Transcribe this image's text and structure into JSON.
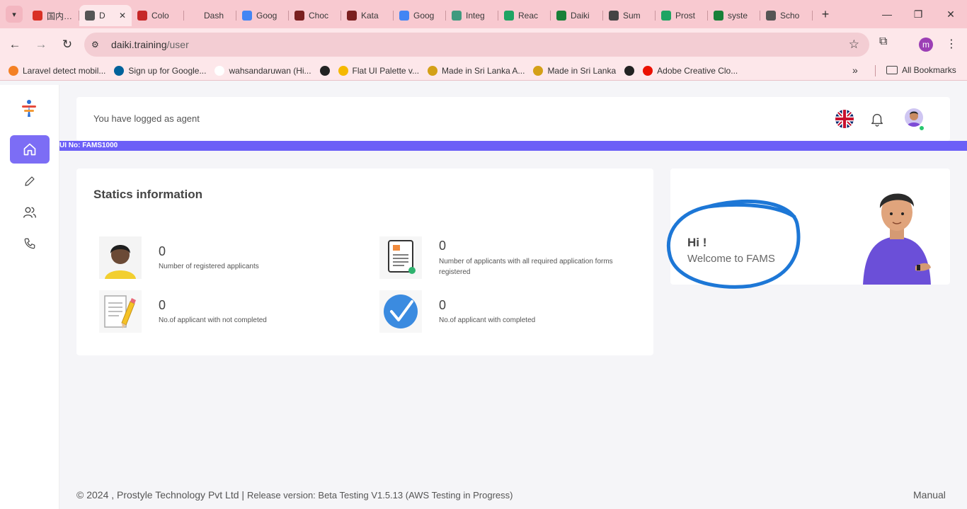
{
  "browser": {
    "tabs": [
      {
        "label": "国内…",
        "color": "#d93025"
      },
      {
        "label": "D",
        "color": "#555555",
        "active": true
      },
      {
        "label": "Colo",
        "color": "#c62828"
      },
      {
        "label": "Dash",
        "color": "#f8c9d0"
      },
      {
        "label": "Goog",
        "color": "#4285f4"
      },
      {
        "label": "Choc",
        "color": "#7a1f1f"
      },
      {
        "label": "Kata",
        "color": "#7a1f1f"
      },
      {
        "label": "Goog",
        "color": "#4285f4"
      },
      {
        "label": "Integ",
        "color": "#3f9a7f"
      },
      {
        "label": "Reac",
        "color": "#1fa463"
      },
      {
        "label": "Daiki",
        "color": "#188038"
      },
      {
        "label": "Sum",
        "color": "#444444"
      },
      {
        "label": "Prost",
        "color": "#1fa463"
      },
      {
        "label": "syste",
        "color": "#188038"
      },
      {
        "label": "Scho",
        "color": "#555555"
      }
    ],
    "url_host": "daiki.training",
    "url_path": "/user",
    "profile_initial": "m",
    "bookmarks": [
      {
        "label": "Laravel detect mobil...",
        "color": "#f48024"
      },
      {
        "label": "Sign up for Google...",
        "color": "#00629b"
      },
      {
        "label": "wahsandaruwan (Hi...",
        "color": "#ffffff"
      },
      {
        "label": "",
        "color": "#222222"
      },
      {
        "label": "Flat UI Palette v...",
        "color": "#f5b800"
      },
      {
        "label": "Made in Sri Lanka A...",
        "color": "#d4a017"
      },
      {
        "label": "Made in Sri Lanka",
        "color": "#d4a017"
      },
      {
        "label": "",
        "color": "#222222"
      },
      {
        "label": "Adobe Creative Clo...",
        "color": "#eb1000"
      }
    ],
    "all_bookmarks_label": "All Bookmarks"
  },
  "app": {
    "status_text": "You have logged as agent",
    "ui_no": "UI No: FAMS1000",
    "stats_title": "Statics information",
    "stats": [
      {
        "value": "0",
        "label": "Number of registered applicants"
      },
      {
        "value": "0",
        "label": "Number of applicants with all required application forms registered"
      },
      {
        "value": "0",
        "label": "No.of applicant with not completed"
      },
      {
        "value": "0",
        "label": "No.of applicant with completed"
      }
    ],
    "welcome": {
      "hi": "Hi !",
      "message": "Welcome to FAMS"
    },
    "footer": {
      "copyright": "© 2024 , Prostyle Technology Pvt Ltd | ",
      "release": "Release version: Beta Testing V1.5.13 (AWS Testing in Progress)",
      "manual": "Manual"
    },
    "accent_color": "#6c5ff7"
  }
}
